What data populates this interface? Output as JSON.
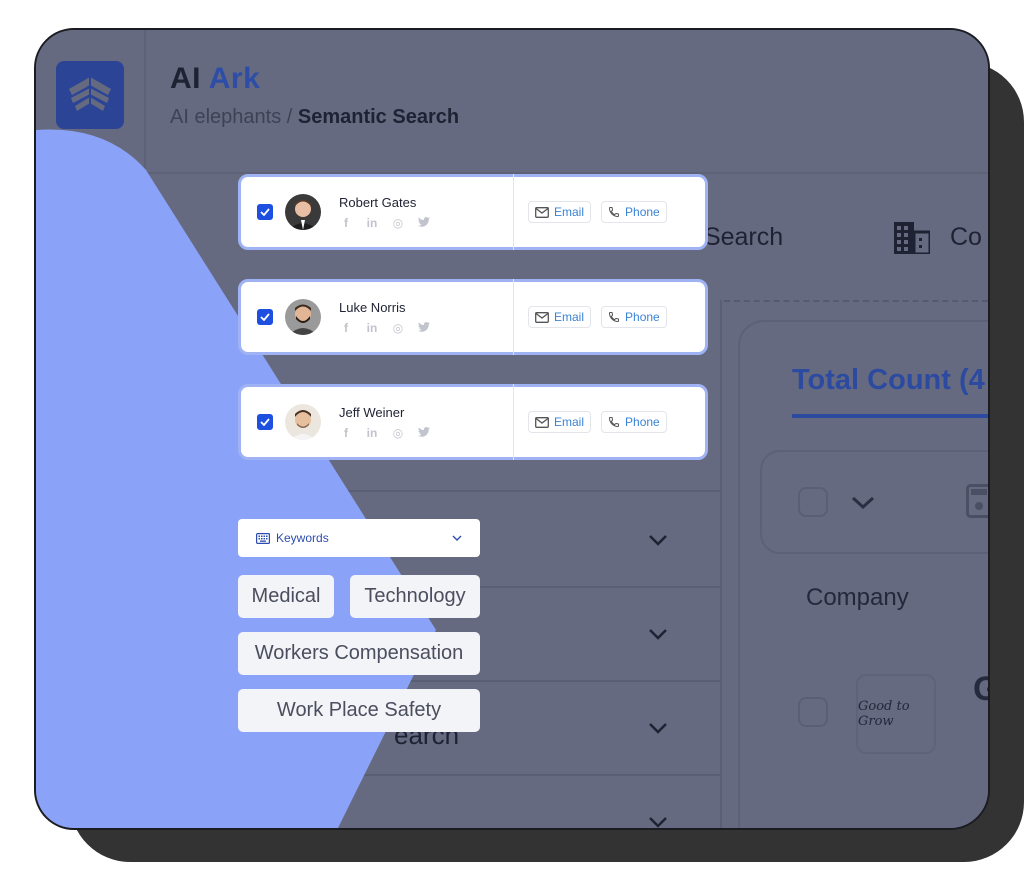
{
  "app": {
    "brand_primary": "AI",
    "brand_accent": "Ark",
    "breadcrumb_parent": "AI elephants /",
    "breadcrumb_current": "Semantic Search",
    "logo_icon": "ark-logo-icon"
  },
  "background": {
    "tab_semantic_partial": "tic Search",
    "tab_company_partial": "Co",
    "partial_row_text": "earch",
    "total_count_label": "Total Count (4",
    "company_header": "Company",
    "company_logo_text": "Good to Grow",
    "company_name_partial": "G"
  },
  "contacts": [
    {
      "name": "Robert Gates",
      "checked": true,
      "avatar_color": "#3a3a3a",
      "email_label": "Email",
      "phone_label": "Phone",
      "socials": [
        "f",
        "in",
        "◎",
        "🐦"
      ]
    },
    {
      "name": "Luke Norris",
      "checked": true,
      "avatar_color": "#8f8f8f",
      "email_label": "Email",
      "phone_label": "Phone",
      "socials": [
        "f",
        "in",
        "◎",
        "🐦"
      ]
    },
    {
      "name": "Jeff Weiner",
      "checked": true,
      "avatar_color": "#e9e4dc",
      "email_label": "Email",
      "phone_label": "Phone",
      "socials": [
        "f",
        "in",
        "◎",
        "🐦"
      ]
    }
  ],
  "keywords": {
    "select_label": "Keywords",
    "tags": [
      "Medical",
      "Technology",
      "Workers Compensation",
      "Work Place Safety"
    ]
  },
  "colors": {
    "accent_blue": "#1d4fe0",
    "link_blue": "#3a83d6",
    "card_border": "#9fb2f4",
    "decor_blue": "#8aa2f8",
    "overlay": "#656a80"
  }
}
